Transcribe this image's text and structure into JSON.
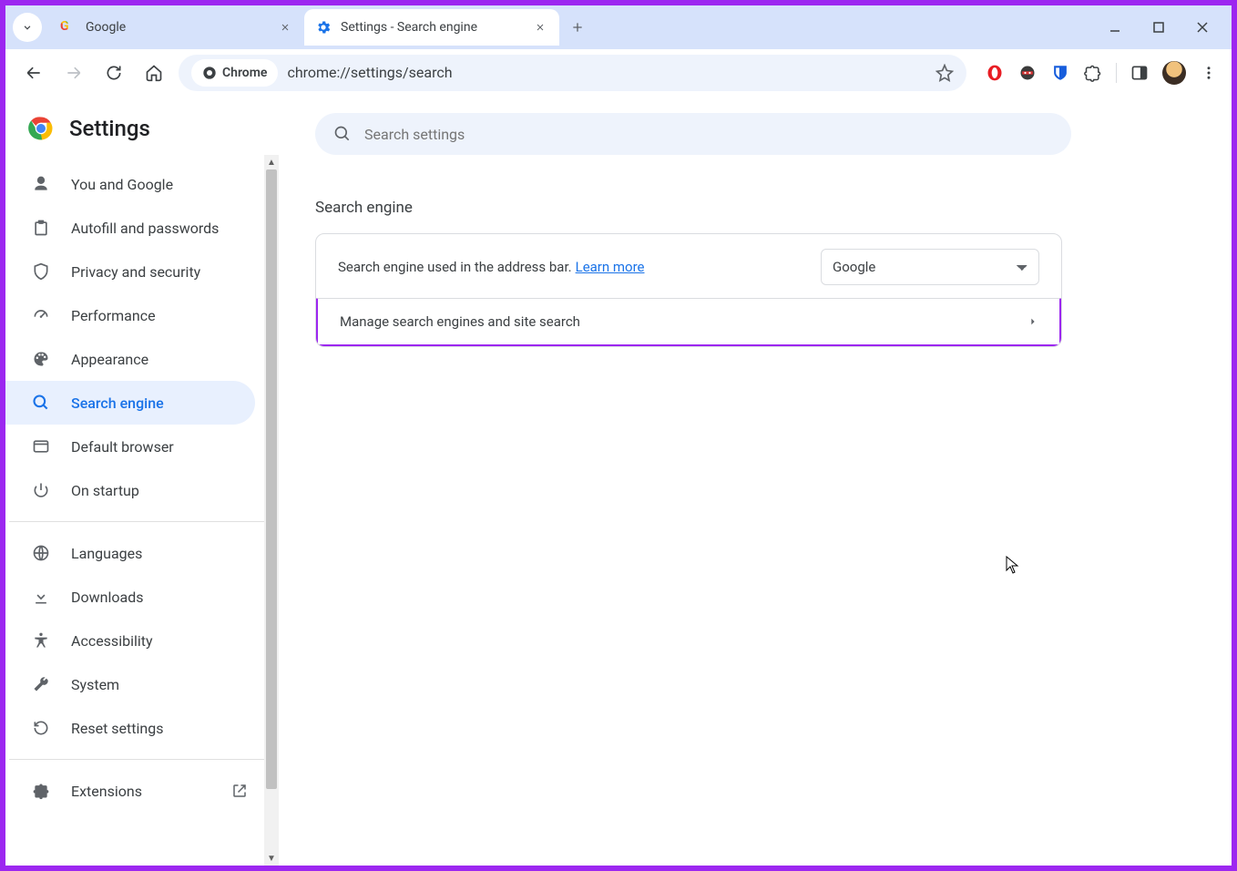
{
  "tabs": [
    {
      "title": "Google"
    },
    {
      "title": "Settings - Search engine"
    }
  ],
  "toolbar": {
    "chip_label": "Chrome",
    "url": "chrome://settings/search"
  },
  "header": {
    "title": "Settings"
  },
  "search": {
    "placeholder": "Search settings"
  },
  "sidebar": {
    "items": [
      {
        "label": "You and Google"
      },
      {
        "label": "Autofill and passwords"
      },
      {
        "label": "Privacy and security"
      },
      {
        "label": "Performance"
      },
      {
        "label": "Appearance"
      },
      {
        "label": "Search engine"
      },
      {
        "label": "Default browser"
      },
      {
        "label": "On startup"
      }
    ],
    "items2": [
      {
        "label": "Languages"
      },
      {
        "label": "Downloads"
      },
      {
        "label": "Accessibility"
      },
      {
        "label": "System"
      },
      {
        "label": "Reset settings"
      }
    ],
    "extensions_label": "Extensions"
  },
  "main": {
    "section_title": "Search engine",
    "row1_text": "Search engine used in the address bar.",
    "learn_more": "Learn more",
    "selected_engine": "Google",
    "row2_text": "Manage search engines and site search"
  }
}
